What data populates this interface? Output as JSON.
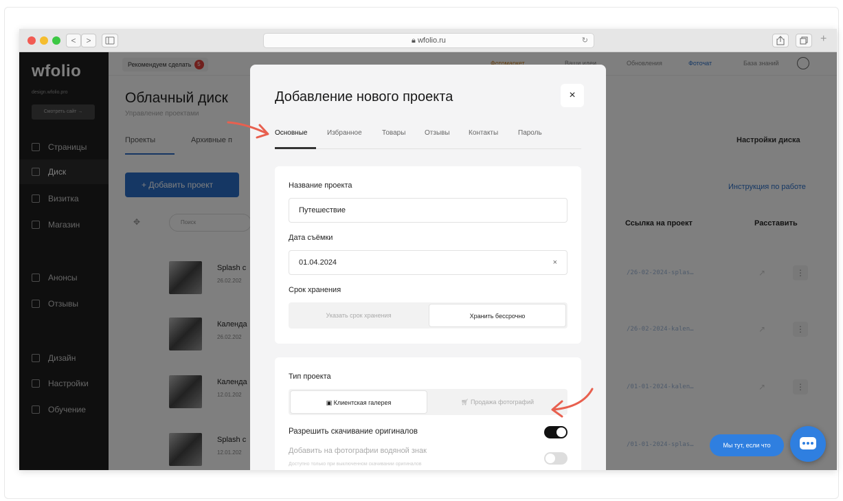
{
  "browser": {
    "url": "wfolio.ru",
    "back": "<",
    "forward": ">",
    "reload": "↻",
    "plus": "+"
  },
  "sidebar": {
    "logo": "wfolio",
    "site": "design.wfolio.pro",
    "site_button": "Смотреть сайт →",
    "items": [
      {
        "label": "Страницы"
      },
      {
        "label": "Диск"
      },
      {
        "label": "Визитка"
      },
      {
        "label": "Магазин"
      },
      {
        "label": "Анонсы"
      },
      {
        "label": "Отзывы"
      },
      {
        "label": "Дизайн"
      },
      {
        "label": "Настройки"
      },
      {
        "label": "Обучение"
      }
    ]
  },
  "topbar": {
    "recommend": "Рекомендуем сделать",
    "badge": "5",
    "links": [
      "Фотомаркет",
      "Ваши идеи",
      "Обновления",
      "Фоточат",
      "База знаний"
    ]
  },
  "page": {
    "title": "Облачный диск",
    "subtitle": "Управление проектами",
    "tab_projects": "Проекты",
    "tab_archive": "Архивные п",
    "disk_settings": "Настройки диска",
    "add_project": "+ Добавить проект",
    "instruction": "Инструкция по работе",
    "search_placeholder": "Поиск",
    "col_link": "Ссылка на проект",
    "col_arrange": "Расставить"
  },
  "rows": [
    {
      "title": "Splash c",
      "date": "26.02.202",
      "link": "/26-02-2024-splas…"
    },
    {
      "title": "Календа",
      "date": "26.02.202",
      "link": "/26-02-2024-kalen…"
    },
    {
      "title": "Календа",
      "date": "12.01.202",
      "link": "/01-01-2024-kalen…"
    },
    {
      "title": "Splash c",
      "date": "12.01.202",
      "link": "/01-01-2024-splas…"
    }
  ],
  "modal": {
    "title": "Добавление нового проекта",
    "close": "×",
    "tabs": [
      "Основные",
      "Избранное",
      "Товары",
      "Отзывы",
      "Контакты",
      "Пароль"
    ],
    "name_label": "Название проекта",
    "name_value": "Путешествие",
    "date_label": "Дата съёмки",
    "date_value": "01.04.2024",
    "date_clear": "×",
    "storage_label": "Срок хранения",
    "storage_set": "Указать срок хранения",
    "storage_forever": "Хранить бессрочно",
    "type_label": "Тип проекта",
    "type_gallery": "Клиентская галерея",
    "type_sale": "Продажа фотографий",
    "allow_download": "Разрешить скачивание оригиналов",
    "allow_download_on": true,
    "watermark": "Добавить на фотографии водяной знак",
    "watermark_on": false,
    "watermark_hint": "Доступно только при выключенном скачивании оригиналов"
  },
  "chat": {
    "label": "Мы тут, если что"
  },
  "colors": {
    "accent": "#2a6fc9",
    "annotation_arrow": "#e8604f"
  }
}
